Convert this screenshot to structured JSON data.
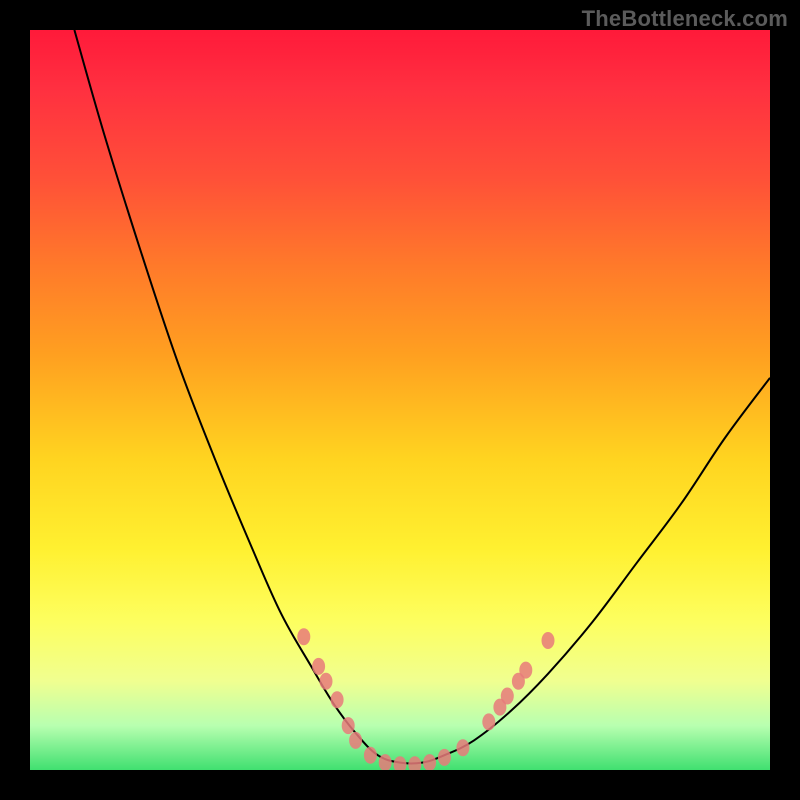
{
  "watermark": "TheBottleneck.com",
  "colors": {
    "frame": "#000000",
    "gradient_top": "#ff1a3a",
    "gradient_mid": "#ffd420",
    "gradient_bottom": "#40e070",
    "marker": "#e87a7a",
    "curve": "#000000"
  },
  "chart_data": {
    "type": "line",
    "title": "",
    "xlabel": "",
    "ylabel": "",
    "xlim": [
      0,
      100
    ],
    "ylim": [
      0,
      100
    ],
    "note": "No axis ticks or labels are rendered. Values below are estimated positions in percent of the 740×740 plot area (x left→right, y measured from top=0).",
    "series": [
      {
        "name": "bottleneck-curve",
        "x": [
          6,
          10,
          15,
          20,
          25,
          30,
          34,
          38,
          41,
          44,
          47,
          50,
          53,
          56,
          60,
          65,
          70,
          76,
          82,
          88,
          94,
          100
        ],
        "y": [
          0,
          14,
          30,
          45,
          58,
          70,
          79,
          86,
          91,
          95,
          98,
          99,
          99,
          98,
          96,
          92,
          87,
          80,
          72,
          64,
          55,
          47
        ]
      }
    ],
    "markers": {
      "name": "highlight-dots",
      "points": [
        {
          "x": 37,
          "y": 82
        },
        {
          "x": 39,
          "y": 86
        },
        {
          "x": 40,
          "y": 88
        },
        {
          "x": 41.5,
          "y": 90.5
        },
        {
          "x": 43,
          "y": 94
        },
        {
          "x": 44,
          "y": 96
        },
        {
          "x": 46,
          "y": 98
        },
        {
          "x": 48,
          "y": 99
        },
        {
          "x": 50,
          "y": 99.3
        },
        {
          "x": 52,
          "y": 99.3
        },
        {
          "x": 54,
          "y": 99
        },
        {
          "x": 56,
          "y": 98.3
        },
        {
          "x": 58.5,
          "y": 97
        },
        {
          "x": 62,
          "y": 93.5
        },
        {
          "x": 63.5,
          "y": 91.5
        },
        {
          "x": 64.5,
          "y": 90
        },
        {
          "x": 66,
          "y": 88
        },
        {
          "x": 67,
          "y": 86.5
        },
        {
          "x": 70,
          "y": 82.5
        }
      ]
    }
  }
}
